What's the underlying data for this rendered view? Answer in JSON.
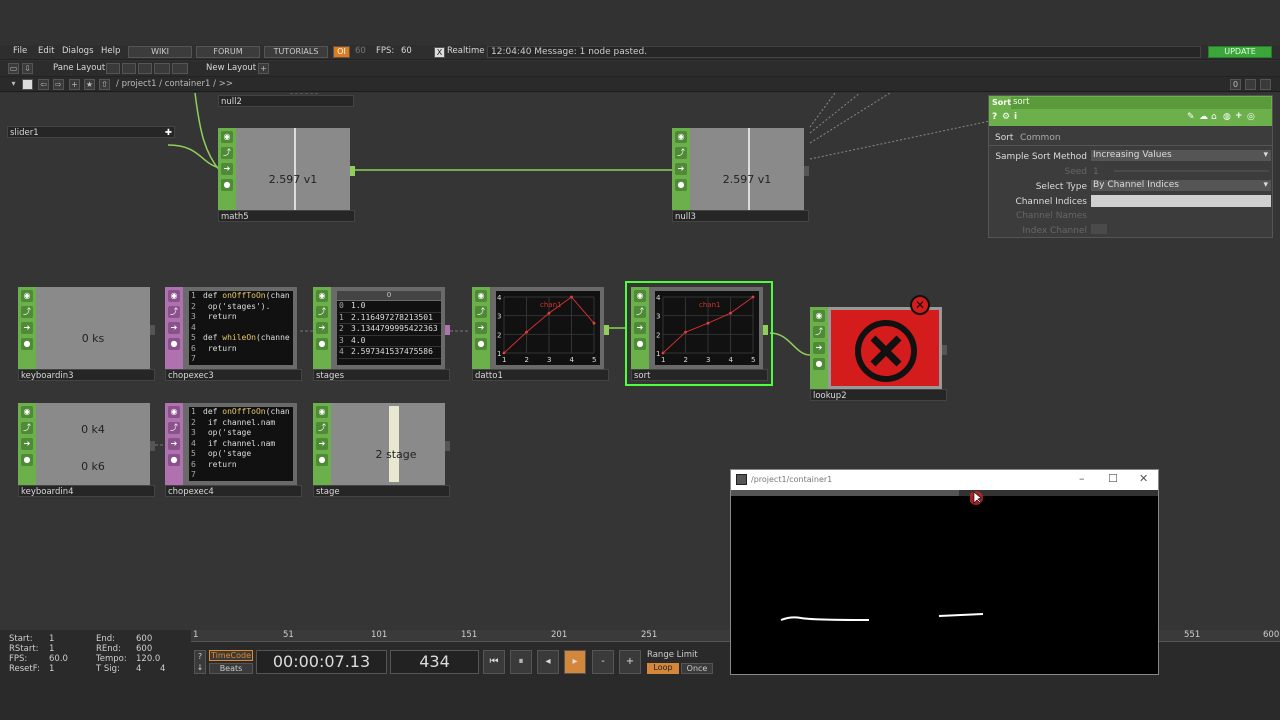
{
  "menu": {
    "file": "File",
    "edit": "Edit",
    "dialogs": "Dialogs",
    "help": "Help",
    "wiki": "WIKI",
    "forum": "FORUM",
    "tutorials": "TUTORIALS",
    "oi": "OI",
    "fps_label": "FPS:",
    "fps_value": "60",
    "fps_setting": "60",
    "realtime_check": "X",
    "realtime": "Realtime",
    "message": "12:04:40 Message: 1 node pasted.",
    "update": "UPDATE"
  },
  "toolbar": {
    "pane_layout": "Pane Layout",
    "new_layout": "New Layout",
    "plus": "+"
  },
  "pathbar": {
    "path": "/ project1 / container1 / >>",
    "zero": "0"
  },
  "nodes": {
    "null2": "null2",
    "slider1": "slider1",
    "math5": {
      "label": "math5",
      "value": "2.597 v1"
    },
    "null3": {
      "label": "null3",
      "value": "2.597 v1"
    },
    "keyboardin3": {
      "label": "keyboardin3",
      "value": "0 ks"
    },
    "chopexec3": {
      "label": "chopexec3",
      "lines": [
        {
          "n": "1",
          "pre": "def ",
          "fn": "onOffToOn",
          "post": "(chan"
        },
        {
          "n": "2",
          "pre": "    op('stages').",
          "fn": "",
          "post": ""
        },
        {
          "n": "3",
          "pre": "    return",
          "fn": "",
          "post": ""
        },
        {
          "n": "4",
          "pre": "",
          "fn": "",
          "post": ""
        },
        {
          "n": "5",
          "pre": "def ",
          "fn": "whileOn",
          "post": "(channe"
        },
        {
          "n": "6",
          "pre": "    return",
          "fn": "",
          "post": ""
        },
        {
          "n": "7",
          "pre": "",
          "fn": "",
          "post": ""
        }
      ]
    },
    "stages": {
      "label": "stages",
      "header": "0",
      "rows": [
        {
          "i": "0",
          "v": "1.0"
        },
        {
          "i": "1",
          "v": "2.116497278213501"
        },
        {
          "i": "2",
          "v": "3.1344799995422363"
        },
        {
          "i": "3",
          "v": "4.0"
        },
        {
          "i": "4",
          "v": "2.597341537475586"
        }
      ]
    },
    "datto1": {
      "label": "datto1"
    },
    "sort": {
      "label": "sort"
    },
    "lookup2": {
      "label": "lookup2"
    },
    "keyboardin4": {
      "label": "keyboardin4",
      "value1": "0 k4",
      "value2": "0 k6"
    },
    "chopexec4": {
      "label": "chopexec4",
      "lines": [
        {
          "n": "1",
          "pre": "def ",
          "fn": "onOffToOn",
          "post": "(chan"
        },
        {
          "n": "2",
          "pre": "    if channel.nam",
          "fn": "",
          "post": ""
        },
        {
          "n": "3",
          "pre": "        op('stage",
          "fn": "",
          "post": ""
        },
        {
          "n": "4",
          "pre": "    if channel.nam",
          "fn": "",
          "post": ""
        },
        {
          "n": "5",
          "pre": "        op('stage",
          "fn": "",
          "post": ""
        },
        {
          "n": "6",
          "pre": "    return",
          "fn": "",
          "post": ""
        },
        {
          "n": "7",
          "pre": "",
          "fn": "",
          "post": ""
        }
      ]
    },
    "stage": {
      "label": "stage",
      "value": "2 stage"
    }
  },
  "charts": {
    "datto1": {
      "series": "chan1",
      "x": [
        1,
        2,
        3,
        4,
        5
      ],
      "y": [
        1.0,
        2.116,
        3.134,
        4.0,
        2.597
      ],
      "xticks": [
        "1",
        "2",
        "3",
        "4",
        "5"
      ],
      "yticks": [
        "1",
        "2",
        "3",
        "4"
      ]
    },
    "sort": {
      "series": "chan1",
      "x": [
        1,
        2,
        3,
        4,
        5
      ],
      "y": [
        1.0,
        2.116,
        2.597,
        3.134,
        4.0
      ],
      "xticks": [
        "1",
        "2",
        "3",
        "4",
        "5"
      ],
      "yticks": [
        "1",
        "2",
        "3",
        "4"
      ]
    }
  },
  "params": {
    "op_type": "Sort",
    "op_name": "sort",
    "tab_sort": "Sort",
    "tab_common": "Common",
    "sample_sort_method_label": "Sample Sort Method",
    "sample_sort_method_value": "Increasing Values",
    "seed_label": "Seed",
    "seed_value": "1",
    "select_type_label": "Select Type",
    "select_type_value": "By Channel Indices",
    "channel_indices_label": "Channel Indices",
    "channel_indices_value": "",
    "channel_names_label": "Channel Names",
    "index_channel_label": "Index Channel"
  },
  "timeline": {
    "start_label": "Start:",
    "start": "1",
    "rstart_label": "RStart:",
    "rstart": "1",
    "fps_label": "FPS:",
    "fps": "60.0",
    "resetf_label": "ResetF:",
    "resetf": "1",
    "end_label": "End:",
    "end": "600",
    "rend_label": "REnd:",
    "rend": "600",
    "tempo_label": "Tempo:",
    "tempo": "120.0",
    "tsig_label": "T Sig:",
    "tsig_a": "4",
    "tsig_b": "4",
    "timecode": "TimeCode",
    "beats": "Beats",
    "time": "00:00:07.13",
    "frame": "434",
    "range_limit": "Range Limit",
    "loop": "Loop",
    "once": "Once",
    "ruler": [
      "1",
      "51",
      "101",
      "151",
      "201",
      "251",
      "551",
      "600"
    ]
  },
  "viewer": {
    "title": "/project1/container1"
  },
  "colors": {
    "operator_green": "#6bb04a",
    "dat_purple": "#b071b0",
    "selected": "#4cff3a",
    "error_red": "#d41c1c",
    "update_green": "#3ba63b"
  }
}
